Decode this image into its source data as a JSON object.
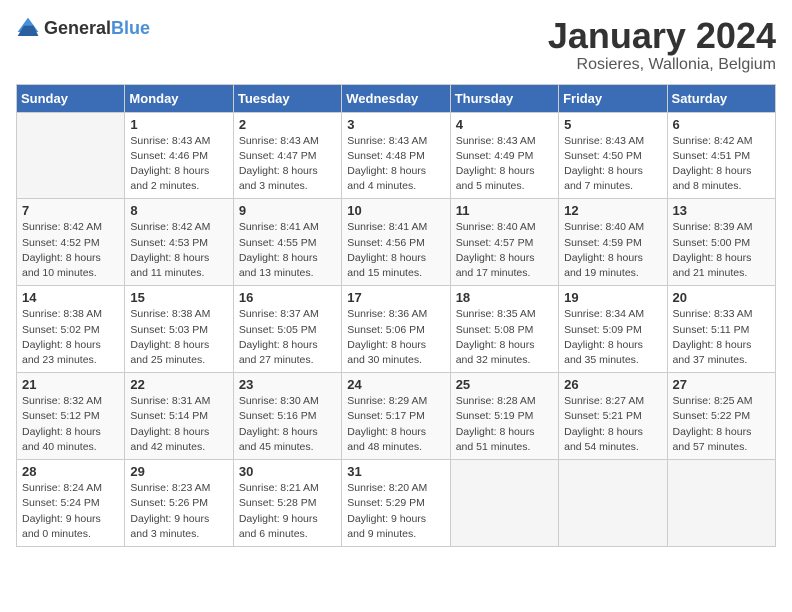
{
  "logo": {
    "text_general": "General",
    "text_blue": "Blue"
  },
  "header": {
    "month_title": "January 2024",
    "location": "Rosieres, Wallonia, Belgium"
  },
  "weekdays": [
    "Sunday",
    "Monday",
    "Tuesday",
    "Wednesday",
    "Thursday",
    "Friday",
    "Saturday"
  ],
  "weeks": [
    [
      {
        "day": "",
        "sunrise": "",
        "sunset": "",
        "daylight": ""
      },
      {
        "day": "1",
        "sunrise": "Sunrise: 8:43 AM",
        "sunset": "Sunset: 4:46 PM",
        "daylight": "Daylight: 8 hours and 2 minutes."
      },
      {
        "day": "2",
        "sunrise": "Sunrise: 8:43 AM",
        "sunset": "Sunset: 4:47 PM",
        "daylight": "Daylight: 8 hours and 3 minutes."
      },
      {
        "day": "3",
        "sunrise": "Sunrise: 8:43 AM",
        "sunset": "Sunset: 4:48 PM",
        "daylight": "Daylight: 8 hours and 4 minutes."
      },
      {
        "day": "4",
        "sunrise": "Sunrise: 8:43 AM",
        "sunset": "Sunset: 4:49 PM",
        "daylight": "Daylight: 8 hours and 5 minutes."
      },
      {
        "day": "5",
        "sunrise": "Sunrise: 8:43 AM",
        "sunset": "Sunset: 4:50 PM",
        "daylight": "Daylight: 8 hours and 7 minutes."
      },
      {
        "day": "6",
        "sunrise": "Sunrise: 8:42 AM",
        "sunset": "Sunset: 4:51 PM",
        "daylight": "Daylight: 8 hours and 8 minutes."
      }
    ],
    [
      {
        "day": "7",
        "sunrise": "Sunrise: 8:42 AM",
        "sunset": "Sunset: 4:52 PM",
        "daylight": "Daylight: 8 hours and 10 minutes."
      },
      {
        "day": "8",
        "sunrise": "Sunrise: 8:42 AM",
        "sunset": "Sunset: 4:53 PM",
        "daylight": "Daylight: 8 hours and 11 minutes."
      },
      {
        "day": "9",
        "sunrise": "Sunrise: 8:41 AM",
        "sunset": "Sunset: 4:55 PM",
        "daylight": "Daylight: 8 hours and 13 minutes."
      },
      {
        "day": "10",
        "sunrise": "Sunrise: 8:41 AM",
        "sunset": "Sunset: 4:56 PM",
        "daylight": "Daylight: 8 hours and 15 minutes."
      },
      {
        "day": "11",
        "sunrise": "Sunrise: 8:40 AM",
        "sunset": "Sunset: 4:57 PM",
        "daylight": "Daylight: 8 hours and 17 minutes."
      },
      {
        "day": "12",
        "sunrise": "Sunrise: 8:40 AM",
        "sunset": "Sunset: 4:59 PM",
        "daylight": "Daylight: 8 hours and 19 minutes."
      },
      {
        "day": "13",
        "sunrise": "Sunrise: 8:39 AM",
        "sunset": "Sunset: 5:00 PM",
        "daylight": "Daylight: 8 hours and 21 minutes."
      }
    ],
    [
      {
        "day": "14",
        "sunrise": "Sunrise: 8:38 AM",
        "sunset": "Sunset: 5:02 PM",
        "daylight": "Daylight: 8 hours and 23 minutes."
      },
      {
        "day": "15",
        "sunrise": "Sunrise: 8:38 AM",
        "sunset": "Sunset: 5:03 PM",
        "daylight": "Daylight: 8 hours and 25 minutes."
      },
      {
        "day": "16",
        "sunrise": "Sunrise: 8:37 AM",
        "sunset": "Sunset: 5:05 PM",
        "daylight": "Daylight: 8 hours and 27 minutes."
      },
      {
        "day": "17",
        "sunrise": "Sunrise: 8:36 AM",
        "sunset": "Sunset: 5:06 PM",
        "daylight": "Daylight: 8 hours and 30 minutes."
      },
      {
        "day": "18",
        "sunrise": "Sunrise: 8:35 AM",
        "sunset": "Sunset: 5:08 PM",
        "daylight": "Daylight: 8 hours and 32 minutes."
      },
      {
        "day": "19",
        "sunrise": "Sunrise: 8:34 AM",
        "sunset": "Sunset: 5:09 PM",
        "daylight": "Daylight: 8 hours and 35 minutes."
      },
      {
        "day": "20",
        "sunrise": "Sunrise: 8:33 AM",
        "sunset": "Sunset: 5:11 PM",
        "daylight": "Daylight: 8 hours and 37 minutes."
      }
    ],
    [
      {
        "day": "21",
        "sunrise": "Sunrise: 8:32 AM",
        "sunset": "Sunset: 5:12 PM",
        "daylight": "Daylight: 8 hours and 40 minutes."
      },
      {
        "day": "22",
        "sunrise": "Sunrise: 8:31 AM",
        "sunset": "Sunset: 5:14 PM",
        "daylight": "Daylight: 8 hours and 42 minutes."
      },
      {
        "day": "23",
        "sunrise": "Sunrise: 8:30 AM",
        "sunset": "Sunset: 5:16 PM",
        "daylight": "Daylight: 8 hours and 45 minutes."
      },
      {
        "day": "24",
        "sunrise": "Sunrise: 8:29 AM",
        "sunset": "Sunset: 5:17 PM",
        "daylight": "Daylight: 8 hours and 48 minutes."
      },
      {
        "day": "25",
        "sunrise": "Sunrise: 8:28 AM",
        "sunset": "Sunset: 5:19 PM",
        "daylight": "Daylight: 8 hours and 51 minutes."
      },
      {
        "day": "26",
        "sunrise": "Sunrise: 8:27 AM",
        "sunset": "Sunset: 5:21 PM",
        "daylight": "Daylight: 8 hours and 54 minutes."
      },
      {
        "day": "27",
        "sunrise": "Sunrise: 8:25 AM",
        "sunset": "Sunset: 5:22 PM",
        "daylight": "Daylight: 8 hours and 57 minutes."
      }
    ],
    [
      {
        "day": "28",
        "sunrise": "Sunrise: 8:24 AM",
        "sunset": "Sunset: 5:24 PM",
        "daylight": "Daylight: 9 hours and 0 minutes."
      },
      {
        "day": "29",
        "sunrise": "Sunrise: 8:23 AM",
        "sunset": "Sunset: 5:26 PM",
        "daylight": "Daylight: 9 hours and 3 minutes."
      },
      {
        "day": "30",
        "sunrise": "Sunrise: 8:21 AM",
        "sunset": "Sunset: 5:28 PM",
        "daylight": "Daylight: 9 hours and 6 minutes."
      },
      {
        "day": "31",
        "sunrise": "Sunrise: 8:20 AM",
        "sunset": "Sunset: 5:29 PM",
        "daylight": "Daylight: 9 hours and 9 minutes."
      },
      {
        "day": "",
        "sunrise": "",
        "sunset": "",
        "daylight": ""
      },
      {
        "day": "",
        "sunrise": "",
        "sunset": "",
        "daylight": ""
      },
      {
        "day": "",
        "sunrise": "",
        "sunset": "",
        "daylight": ""
      }
    ]
  ]
}
